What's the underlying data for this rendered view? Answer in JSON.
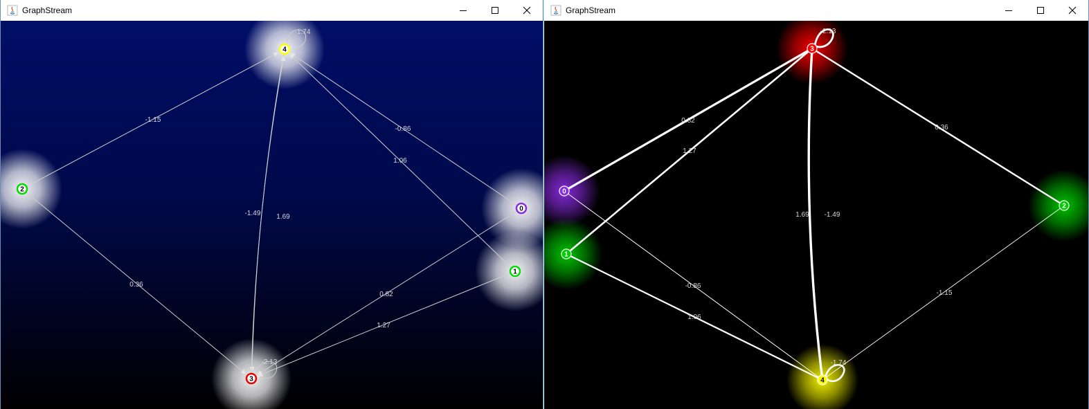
{
  "windows": [
    {
      "id": "left",
      "title": "GraphStream",
      "controls": {
        "minimize": "minimize-icon",
        "maximize": "maximize-icon",
        "close": "close-icon"
      },
      "theme": {
        "background_top": "#000e66",
        "background_bottom": "#000000",
        "edge_color": "#d0d0d0",
        "halo_color": "#ffffff"
      },
      "nodes": [
        {
          "id": "4",
          "label": "4",
          "ring_color": "#ffff00"
        },
        {
          "id": "2",
          "label": "2",
          "ring_color": "#00dd00"
        },
        {
          "id": "0",
          "label": "0",
          "ring_color": "#8a2be2"
        },
        {
          "id": "1",
          "label": "1",
          "ring_color": "#00dd00"
        },
        {
          "id": "3",
          "label": "3",
          "ring_color": "#ee0000"
        }
      ],
      "edges": [
        {
          "from": "2",
          "to": "4",
          "weight": "-1.15"
        },
        {
          "from": "0",
          "to": "4",
          "weight": "-0.86"
        },
        {
          "from": "1",
          "to": "4",
          "weight": "1.06"
        },
        {
          "from": "4",
          "to": "3",
          "weight": "-1.49"
        },
        {
          "from": "3",
          "to": "4",
          "weight": "1.69"
        },
        {
          "from": "2",
          "to": "3",
          "weight": "0.36"
        },
        {
          "from": "0",
          "to": "3",
          "weight": "0.82"
        },
        {
          "from": "1",
          "to": "3",
          "weight": "1.27"
        },
        {
          "from": "4",
          "to": "4",
          "weight": "-1.74"
        },
        {
          "from": "3",
          "to": "3",
          "weight": "-2.13"
        }
      ]
    },
    {
      "id": "right",
      "title": "GraphStream",
      "controls": {
        "minimize": "minimize-icon",
        "maximize": "maximize-icon",
        "close": "close-icon"
      },
      "theme": {
        "background": "#000000",
        "edge_color": "#ffffff"
      },
      "nodes": [
        {
          "id": "3",
          "label": "3",
          "fill_color": "#ff0000"
        },
        {
          "id": "0",
          "label": "0",
          "fill_color": "#8a2be2"
        },
        {
          "id": "1",
          "label": "1",
          "fill_color": "#00cc00"
        },
        {
          "id": "2",
          "label": "2",
          "fill_color": "#00cc00"
        },
        {
          "id": "4",
          "label": "4",
          "fill_color": "#ffff00"
        }
      ],
      "edges": [
        {
          "from": "0",
          "to": "3",
          "weight": "0.82"
        },
        {
          "from": "1",
          "to": "3",
          "weight": "1.27"
        },
        {
          "from": "2",
          "to": "3",
          "weight": "0.36"
        },
        {
          "from": "4",
          "to": "3",
          "weight": "1.69"
        },
        {
          "from": "3",
          "to": "4",
          "weight": "-1.49"
        },
        {
          "from": "0",
          "to": "4",
          "weight": "-0.86"
        },
        {
          "from": "1",
          "to": "4",
          "weight": "1.06"
        },
        {
          "from": "2",
          "to": "4",
          "weight": "-1.15"
        },
        {
          "from": "3",
          "to": "3",
          "weight": "-2.13"
        },
        {
          "from": "4",
          "to": "4",
          "weight": "-1.74"
        }
      ]
    }
  ]
}
